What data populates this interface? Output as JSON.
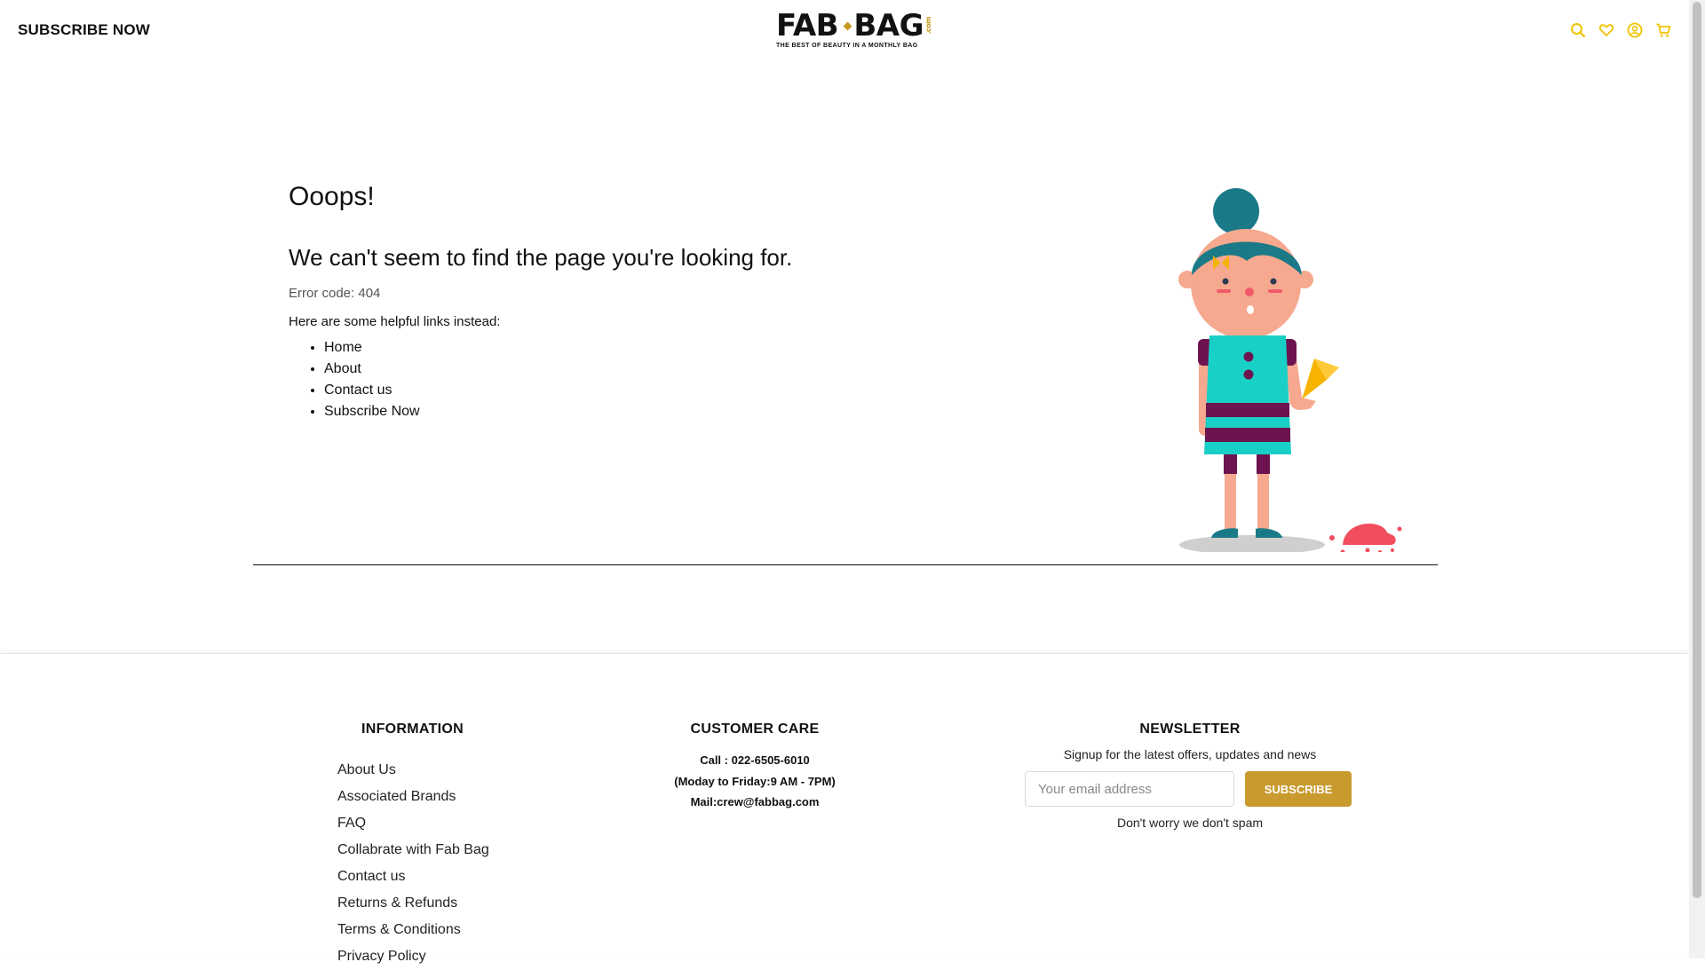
{
  "header": {
    "subscribe_label": "SUBSCRIBE NOW",
    "logo": {
      "main_left": "FAB",
      "main_right": "BAG",
      "com": ".com",
      "tagline": "THE BEST OF BEAUTY IN A MONTHLY BAG"
    },
    "icons": [
      "search-icon",
      "heart-icon",
      "user-icon",
      "cart-icon"
    ],
    "icon_color": "#f0c400"
  },
  "error": {
    "title": "Ooops!",
    "message": "We can't seem to find the page you're looking for.",
    "code_text": "Error code: 404",
    "helpful_text": "Here are some helpful links instead:",
    "links": [
      "Home",
      "About",
      "Contact us",
      "Subscribe Now"
    ]
  },
  "footer": {
    "information": {
      "heading": "INFORMATION",
      "links": [
        "About Us",
        "Associated Brands",
        "FAQ",
        "Collabrate with Fab Bag",
        "Contact us",
        "Returns & Refunds",
        "Terms & Conditions",
        "Privacy Policy"
      ]
    },
    "customer_care": {
      "heading": "CUSTOMER CARE",
      "call": "Call : 022-6505-6010",
      "hours": "(Moday to Friday:9 AM - 7PM)",
      "mail": "Mail:crew@fabbag.com"
    },
    "newsletter": {
      "heading": "NEWSLETTER",
      "subtitle": "Signup for the latest offers, updates and news",
      "email_placeholder": "Your email address",
      "button_label": "SUBSCRIBE",
      "note": "Don't worry we don't spam"
    }
  },
  "colors": {
    "accent_gold": "#c99a2e",
    "icon_yellow": "#f0c400"
  }
}
